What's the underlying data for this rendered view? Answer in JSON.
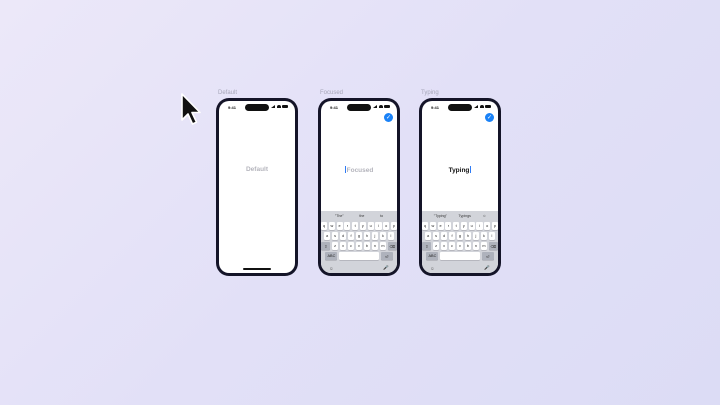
{
  "frames": [
    {
      "label": "Default",
      "time": "9:41",
      "text": "Default",
      "state": "default"
    },
    {
      "label": "Focused",
      "time": "9:41",
      "text": "Focused",
      "state": "focused",
      "suggestions": [
        "\"The\"",
        "the",
        "to"
      ],
      "keys_row1": [
        "q",
        "w",
        "e",
        "r",
        "t",
        "y",
        "u",
        "i",
        "o",
        "p"
      ],
      "keys_row2": [
        "a",
        "s",
        "d",
        "f",
        "g",
        "h",
        "j",
        "k",
        "l"
      ],
      "keys_row3": [
        "z",
        "x",
        "c",
        "v",
        "b",
        "n",
        "m"
      ],
      "key_numbers": "ABC",
      "key_return": "⏎"
    },
    {
      "label": "Typing",
      "time": "9:41",
      "text": "Typing",
      "state": "typing",
      "suggestions": [
        "\"Typing\"",
        "Typings",
        "☺"
      ],
      "keys_row1": [
        "q",
        "w",
        "e",
        "r",
        "t",
        "y",
        "u",
        "i",
        "o",
        "p"
      ],
      "keys_row2": [
        "a",
        "s",
        "d",
        "f",
        "g",
        "h",
        "j",
        "k",
        "l"
      ],
      "keys_row3": [
        "z",
        "x",
        "c",
        "v",
        "b",
        "n",
        "m"
      ],
      "key_numbers": "ABC",
      "key_return": "⏎"
    }
  ],
  "icons": {
    "done": "✓",
    "emoji": "☺",
    "mic": "🎤",
    "shift": "⇧",
    "delete": "⌫"
  },
  "colors": {
    "accent": "#1a82f7",
    "caret": "#2f7cf6",
    "phone_frame": "#141428"
  }
}
